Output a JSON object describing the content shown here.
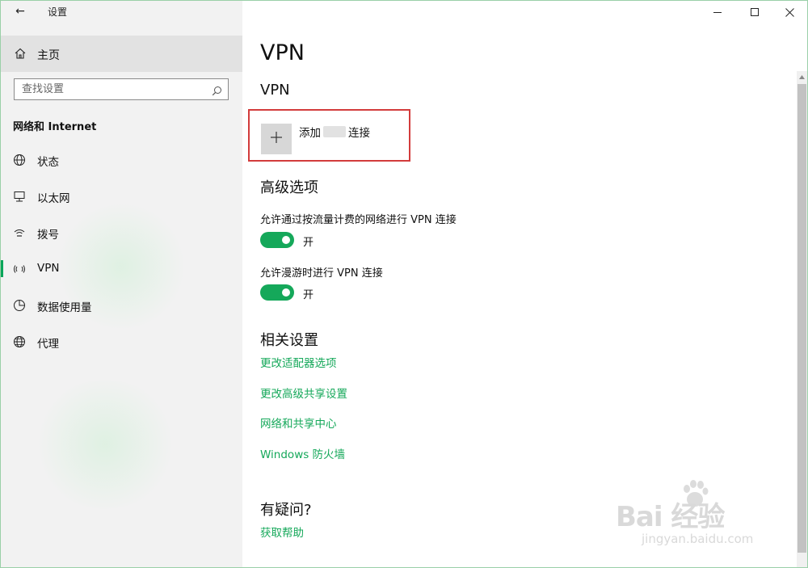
{
  "window": {
    "title": "设置",
    "back_glyph": "←",
    "minimize_icon": "minimize-icon",
    "maximize_icon": "maximize-icon",
    "close_icon": "close-icon"
  },
  "sidebar": {
    "home_label": "主页",
    "search_placeholder": "查找设置",
    "section_title": "网络和 Internet",
    "items": [
      {
        "label": "状态",
        "icon": "globe-status-icon",
        "selected": false
      },
      {
        "label": "以太网",
        "icon": "ethernet-icon",
        "selected": false
      },
      {
        "label": "拨号",
        "icon": "dialup-icon",
        "selected": false
      },
      {
        "label": "VPN",
        "icon": "vpn-icon",
        "selected": true
      },
      {
        "label": "数据使用量",
        "icon": "data-usage-icon",
        "selected": false
      },
      {
        "label": "代理",
        "icon": "proxy-globe-icon",
        "selected": false
      }
    ]
  },
  "main": {
    "page_title": "VPN",
    "vpn_section_title": "VPN",
    "add_vpn": {
      "prefix": "添加",
      "suffix": "连接"
    },
    "advanced_title": "高级选项",
    "options": [
      {
        "label": "允许通过按流量计费的网络进行 VPN 连接",
        "state": "开"
      },
      {
        "label": "允许漫游时进行 VPN 连接",
        "state": "开"
      }
    ],
    "related_title": "相关设置",
    "related_links": [
      "更改适配器选项",
      "更改高级共享设置",
      "网络和共享中心",
      "Windows 防火墙"
    ],
    "help_title": "有疑问?",
    "help_link": "获取帮助"
  },
  "watermark": {
    "logo": "Bai  经验",
    "url": "jingyan.baidu.com"
  },
  "colors": {
    "accent": "#15a85a",
    "highlight_border": "#d33c3c",
    "sidebar_bg": "#f2f2f2"
  }
}
